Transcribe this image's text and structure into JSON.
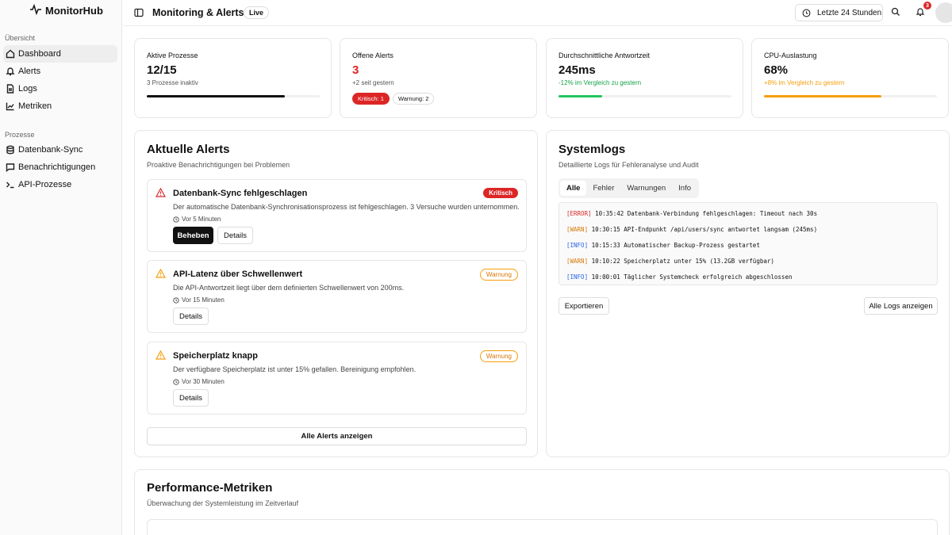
{
  "app": {
    "name": "MonitorHub"
  },
  "sidebar": {
    "section1": "Übersicht",
    "items1": [
      {
        "label": "Dashboard",
        "icon": "home-icon"
      },
      {
        "label": "Alerts",
        "icon": "bell-icon"
      },
      {
        "label": "Logs",
        "icon": "file-icon"
      },
      {
        "label": "Metriken",
        "icon": "chart-icon"
      }
    ],
    "section2": "Prozesse",
    "items2": [
      {
        "label": "Datenbank-Sync",
        "icon": "database-icon"
      },
      {
        "label": "Benachrichtigungen",
        "icon": "message-icon"
      },
      {
        "label": "API-Prozesse",
        "icon": "terminal-icon"
      }
    ]
  },
  "header": {
    "title": "Monitoring & Alerts",
    "badge": "Live",
    "range": "Letzte 24 Stunden",
    "notification_count": "3"
  },
  "stats": [
    {
      "label": "Aktive Prozesse",
      "value": "12/15",
      "sub": "3 Prozesse inaktiv",
      "progress": 0.8,
      "color": "#111111"
    },
    {
      "label": "Offene Alerts",
      "value": "3",
      "sub": "+2 seit gestern",
      "pill_critical": "Kritisch: 1",
      "pill_warning": "Warnung: 2"
    },
    {
      "label": "Durchschnittliche Antwortzeit",
      "value": "245ms",
      "sub": "-12% im Vergleich zu gestern",
      "progress": 0.25,
      "color": "#22c55e"
    },
    {
      "label": "CPU-Auslastung",
      "value": "68%",
      "sub": "+8% im Vergleich zu gestern",
      "progress": 0.68,
      "color": "#f59e0b"
    }
  ],
  "alerts_panel": {
    "title": "Aktuelle Alerts",
    "subtitle": "Proaktive Benachrichtigungen bei Problemen",
    "alerts": [
      {
        "title": "Datenbank-Sync fehlgeschlagen",
        "desc": "Der automatische Datenbank-Synchronisationsprozess ist fehlgeschlagen. 3 Versuche wurden unternommen.",
        "time": "Vor 5 Minuten",
        "badge": "Kritisch",
        "primary": "Beheben",
        "secondary": "Details"
      },
      {
        "title": "API-Latenz über Schwellenwert",
        "desc": "Die API-Antwortzeit liegt über dem definierten Schwellenwert von 200ms.",
        "time": "Vor 15 Minuten",
        "badge": "Warnung",
        "secondary": "Details"
      },
      {
        "title": "Speicherplatz knapp",
        "desc": "Der verfügbare Speicherplatz ist unter 15% gefallen. Bereinigung empfohlen.",
        "time": "Vor 30 Minuten",
        "badge": "Warnung",
        "secondary": "Details"
      }
    ],
    "show_all": "Alle Alerts anzeigen"
  },
  "logs_panel": {
    "title": "Systemlogs",
    "subtitle": "Detaillierte Logs für Fehleranalyse und Audit",
    "tabs": [
      "Alle",
      "Fehler",
      "Warnungen",
      "Info"
    ],
    "lines": [
      {
        "level": "ERROR",
        "tag": "[ERROR]",
        "time": "10:35:42",
        "msg": "Datenbank-Verbindung fehlgeschlagen: Timeout nach 30s"
      },
      {
        "level": "WARN",
        "tag": "[WARN]",
        "time": "10:30:15",
        "msg": "API-Endpunkt /api/users/sync antwortet langsam (245ms)"
      },
      {
        "level": "INFO",
        "tag": "[INFO]",
        "time": "10:15:33",
        "msg": "Automatischer Backup-Prozess gestartet"
      },
      {
        "level": "WARN",
        "tag": "[WARN]",
        "time": "10:10:22",
        "msg": "Speicherplatz unter 15% (13.2GB verfügbar)"
      },
      {
        "level": "INFO",
        "tag": "[INFO]",
        "time": "10:00:01",
        "msg": "Täglicher Systemcheck erfolgreich abgeschlossen"
      }
    ],
    "export": "Exportieren",
    "show_all": "Alle Logs anzeigen"
  },
  "performance_panel": {
    "title": "Performance-Metriken",
    "subtitle": "Überwachung der Systemleistung im Zeitverlauf"
  }
}
